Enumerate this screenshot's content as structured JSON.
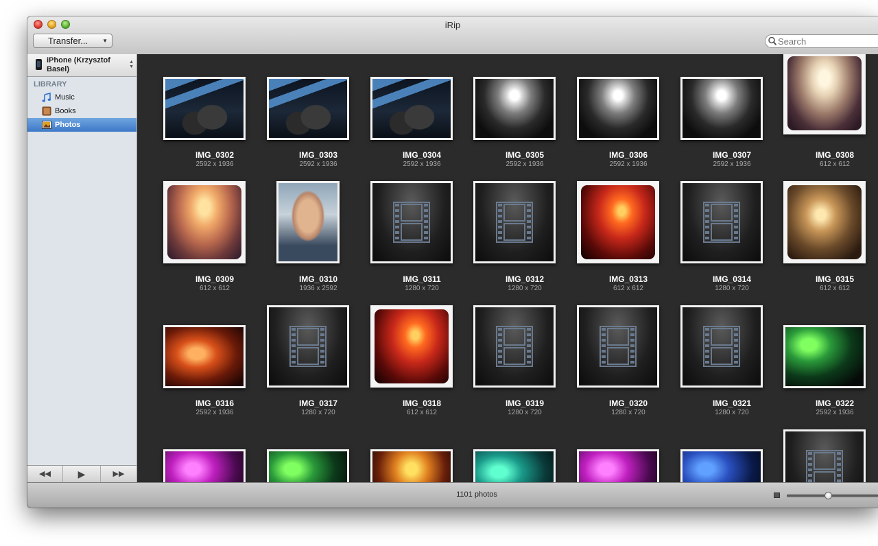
{
  "window": {
    "title": "iRip"
  },
  "toolbar": {
    "transfer_label": "Transfer...",
    "search_placeholder": "Search"
  },
  "sidebar": {
    "device_name": "iPhone (Krzysztof Basel)",
    "library_header": "LIBRARY",
    "items": [
      {
        "label": "Music",
        "icon": "music-note-icon",
        "selected": false
      },
      {
        "label": "Books",
        "icon": "book-icon",
        "selected": false
      },
      {
        "label": "Photos",
        "icon": "photos-icon",
        "selected": true
      }
    ],
    "controls": [
      "rewind-icon",
      "play-icon",
      "fast-forward-icon"
    ]
  },
  "photos": [
    {
      "name": "IMG_0302",
      "dims": "2592 x 1936",
      "kind": "photo-bridge-couple"
    },
    {
      "name": "IMG_0303",
      "dims": "2592 x 1936",
      "kind": "photo-bridge-couple"
    },
    {
      "name": "IMG_0304",
      "dims": "2592 x 1936",
      "kind": "photo-bridge-couple"
    },
    {
      "name": "IMG_0305",
      "dims": "2592 x 1936",
      "kind": "photo-tunnel-light"
    },
    {
      "name": "IMG_0306",
      "dims": "2592 x 1936",
      "kind": "photo-tunnel-light"
    },
    {
      "name": "IMG_0307",
      "dims": "2592 x 1936",
      "kind": "photo-tunnel-light"
    },
    {
      "name": "IMG_0308",
      "dims": "612 x 612",
      "kind": "photo-tunnel-vintage"
    },
    {
      "name": "IMG_0309",
      "dims": "612 x 612",
      "kind": "photo-sunset-vintage"
    },
    {
      "name": "IMG_0310",
      "dims": "1936 x 2592",
      "kind": "photo-portrait"
    },
    {
      "name": "IMG_0311",
      "dims": "1280 x 720",
      "kind": "video"
    },
    {
      "name": "IMG_0312",
      "dims": "1280 x 720",
      "kind": "video"
    },
    {
      "name": "IMG_0313",
      "dims": "612 x 612",
      "kind": "photo-concert-red"
    },
    {
      "name": "IMG_0314",
      "dims": "1280 x 720",
      "kind": "video"
    },
    {
      "name": "IMG_0315",
      "dims": "612 x 612",
      "kind": "photo-concert-stage"
    },
    {
      "name": "IMG_0316",
      "dims": "2592 x 1936",
      "kind": "photo-concert-orange"
    },
    {
      "name": "IMG_0317",
      "dims": "1280 x 720",
      "kind": "video"
    },
    {
      "name": "IMG_0318",
      "dims": "612 x 612",
      "kind": "photo-concert-red"
    },
    {
      "name": "IMG_0319",
      "dims": "1280 x 720",
      "kind": "video"
    },
    {
      "name": "IMG_0320",
      "dims": "1280 x 720",
      "kind": "video"
    },
    {
      "name": "IMG_0321",
      "dims": "1280 x 720",
      "kind": "video"
    },
    {
      "name": "IMG_0322",
      "dims": "2592 x 1936",
      "kind": "photo-concert-green"
    },
    {
      "name": "",
      "dims": "",
      "kind": "photo-concert-pink"
    },
    {
      "name": "",
      "dims": "",
      "kind": "photo-concert-green"
    },
    {
      "name": "",
      "dims": "",
      "kind": "photo-concert-yellow"
    },
    {
      "name": "",
      "dims": "",
      "kind": "photo-concert-teal"
    },
    {
      "name": "",
      "dims": "",
      "kind": "photo-concert-pink"
    },
    {
      "name": "",
      "dims": "",
      "kind": "photo-concert-blue"
    },
    {
      "name": "",
      "dims": "",
      "kind": "video"
    }
  ],
  "statusbar": {
    "count_label": "1101 photos",
    "zoom_level": 0.45
  }
}
